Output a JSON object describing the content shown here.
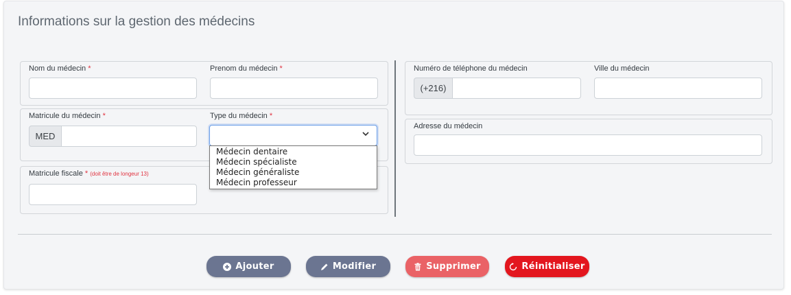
{
  "card": {
    "title": "Informations sur la gestion des médecins"
  },
  "left": {
    "nom_label": "Nom du médecin",
    "prenom_label": "Prenom du médecin",
    "matricule_label": "Matricule du médecin",
    "matricule_prefix": "MED",
    "type_label": "Type du médecin",
    "fiscale_label": "Matricule fiscale",
    "fiscale_hint": "(doit être de longeur 13)",
    "required_mark": "*",
    "type_options": [
      "Médecin dentaire",
      "Médecin spécialiste",
      "Médecin généraliste",
      "Médecin professeur"
    ]
  },
  "right": {
    "tel_label": "Numéro de téléphone du médecin",
    "tel_prefix": "(+216)",
    "ville_label": "Ville du médecin",
    "adresse_label": "Adresse du médecin"
  },
  "actions": {
    "ajouter": "Ajouter",
    "modifier": "Modifier",
    "supprimer": "Supprimer",
    "reinitialiser": "Réinitialiser"
  },
  "colors": {
    "slate": "#6b7591",
    "danger_soft": "#ea6266",
    "danger": "#e3161e",
    "required": "#e0323f"
  }
}
